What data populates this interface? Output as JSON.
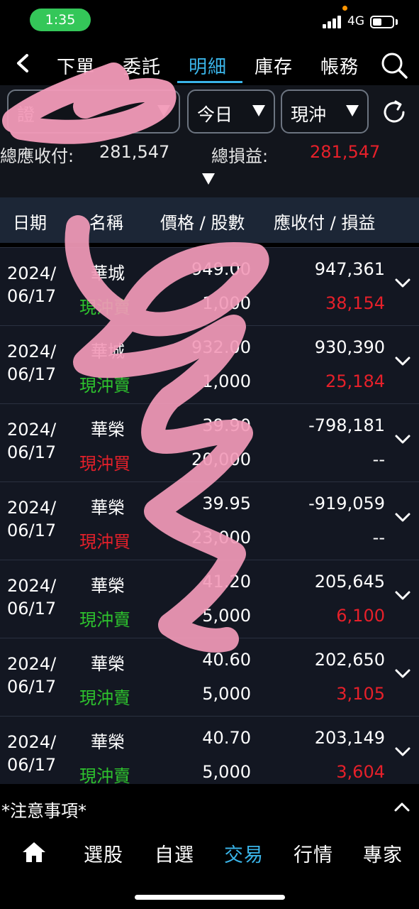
{
  "status_bar": {
    "time": "1:35",
    "network": "4G"
  },
  "nav": {
    "tabs": [
      {
        "label": "下單"
      },
      {
        "label": "委託"
      },
      {
        "label": "明細"
      },
      {
        "label": "庫存"
      },
      {
        "label": "帳務"
      }
    ],
    "active_tab": "明細",
    "icons": {
      "back": "chevron-left-icon",
      "search": "search-icon"
    }
  },
  "filters": {
    "account": "證",
    "date": "今日",
    "type": "現沖"
  },
  "summary": {
    "receivable_label": "總應收付:",
    "receivable_value": "281,547",
    "pnl_label": "總損益:",
    "pnl_value": "281,547"
  },
  "table": {
    "headers": [
      "日期",
      "名稱",
      "價格 / 股數",
      "應收付 / 損益"
    ],
    "rows": [
      {
        "date_line1": "2024/",
        "date_line2": "06/17",
        "name": "華城",
        "side": "現沖賣",
        "price": "949.00",
        "qty": "1,000",
        "amount": "947,361",
        "pnl": "38,154"
      },
      {
        "date_line1": "2024/",
        "date_line2": "06/17",
        "name": "華城",
        "side": "現沖賣",
        "price": "932.00",
        "qty": "1,000",
        "amount": "930,390",
        "pnl": "25,184"
      },
      {
        "date_line1": "2024/",
        "date_line2": "06/17",
        "name": "華榮",
        "side": "現沖買",
        "price": "39.90",
        "qty": "20,000",
        "amount": "-798,181",
        "pnl": "--"
      },
      {
        "date_line1": "2024/",
        "date_line2": "06/17",
        "name": "華榮",
        "side": "現沖買",
        "price": "39.95",
        "qty": "23,000",
        "amount": "-919,059",
        "pnl": "--"
      },
      {
        "date_line1": "2024/",
        "date_line2": "06/17",
        "name": "華榮",
        "side": "現沖賣",
        "price": "41.20",
        "qty": "5,000",
        "amount": "205,645",
        "pnl": "6,100"
      },
      {
        "date_line1": "2024/",
        "date_line2": "06/17",
        "name": "華榮",
        "side": "現沖賣",
        "price": "40.60",
        "qty": "5,000",
        "amount": "202,650",
        "pnl": "3,105"
      },
      {
        "date_line1": "2024/",
        "date_line2": "06/17",
        "name": "華榮",
        "side": "現沖賣",
        "price": "40.70",
        "qty": "5,000",
        "amount": "203,149",
        "pnl": "3,604"
      }
    ]
  },
  "notice": {
    "label": "*注意事項*"
  },
  "bottom_nav": {
    "items": [
      {
        "label": "選股"
      },
      {
        "label": "自選"
      },
      {
        "label": "交易"
      },
      {
        "label": "行情"
      },
      {
        "label": "專家"
      }
    ],
    "active_item": "交易",
    "home_icon": "home-icon"
  },
  "colors": {
    "accent": "#3ab4e8",
    "buy": "#e6202a",
    "sell": "#2ec42e",
    "profit": "#e6202a",
    "redaction": "#f29ab8"
  }
}
